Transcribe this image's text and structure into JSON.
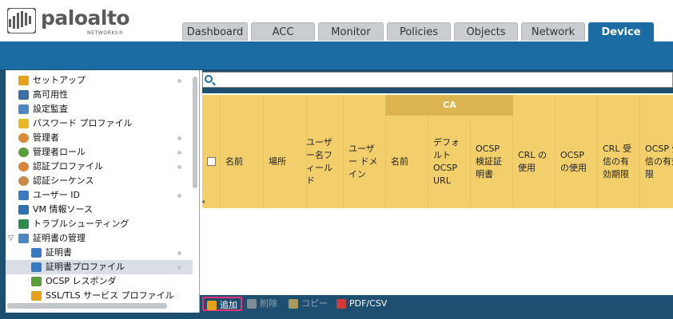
{
  "app": {
    "logo_text": "paloalto",
    "logo_sub": "NETWORKS®"
  },
  "tabs": [
    {
      "label": "Dashboard",
      "active": false
    },
    {
      "label": "ACC",
      "active": false
    },
    {
      "label": "Monitor",
      "active": false
    },
    {
      "label": "Policies",
      "active": false
    },
    {
      "label": "Objects",
      "active": false
    },
    {
      "label": "Network",
      "active": false
    },
    {
      "label": "Device",
      "active": true
    }
  ],
  "sidebar": {
    "items": [
      {
        "label": "セットアップ",
        "icon": "setup-icon",
        "dot": true
      },
      {
        "label": "高可用性",
        "icon": "high-availability-icon",
        "dot": false
      },
      {
        "label": "設定監査",
        "icon": "config-audit-icon",
        "dot": false
      },
      {
        "label": "パスワード プロファイル",
        "icon": "password-profile-icon",
        "dot": false
      },
      {
        "label": "管理者",
        "icon": "administrator-icon",
        "dot": true
      },
      {
        "label": "管理者ロール",
        "icon": "admin-role-icon",
        "dot": true
      },
      {
        "label": "認証プロファイル",
        "icon": "auth-profile-icon",
        "dot": true
      },
      {
        "label": "認証シーケンス",
        "icon": "auth-sequence-icon",
        "dot": false
      },
      {
        "label": "ユーザー ID",
        "icon": "user-id-icon",
        "dot": true
      },
      {
        "label": "VM 情報ソース",
        "icon": "vm-info-source-icon",
        "dot": false
      },
      {
        "label": "トラブルシューティング",
        "icon": "troubleshooting-icon",
        "dot": false
      },
      {
        "label": "証明書の管理",
        "icon": "certificate-management-icon",
        "dot": false
      },
      {
        "label": "証明書",
        "icon": "certificate-icon",
        "dot": true
      },
      {
        "label": "証明書プロファイル",
        "icon": "certificate-profile-icon",
        "dot": true
      },
      {
        "label": "OCSP レスポンダ",
        "icon": "ocsp-responder-icon",
        "dot": false
      },
      {
        "label": "SSL/TLS サービス プロファイル",
        "icon": "ssl-tls-profile-icon",
        "dot": false
      }
    ]
  },
  "search": {
    "placeholder": ""
  },
  "table": {
    "group_header": "CA",
    "columns": [
      {
        "label": "名前"
      },
      {
        "label": "場所"
      },
      {
        "label": "ユーザー名フィールド"
      },
      {
        "label": "ユーザー ドメイン"
      },
      {
        "label": "名前"
      },
      {
        "label": "デフォルト OCSP URL"
      },
      {
        "label": "OCSP 検証証明書"
      },
      {
        "label": "CRL の使用"
      },
      {
        "label": "OCSP の使用"
      },
      {
        "label": "CRL 受信の有効期限"
      },
      {
        "label": "OCSP 受信の有効期限"
      }
    ]
  },
  "toolbar": {
    "add_label": "追加",
    "delete_label": "削除",
    "copy_label": "コピー",
    "pdf_label": "PDF/CSV"
  },
  "colors": {
    "brand_blue": "#1b6ca2",
    "header_yellow": "#f3cf6c",
    "highlight_pink": "#e6317a"
  }
}
